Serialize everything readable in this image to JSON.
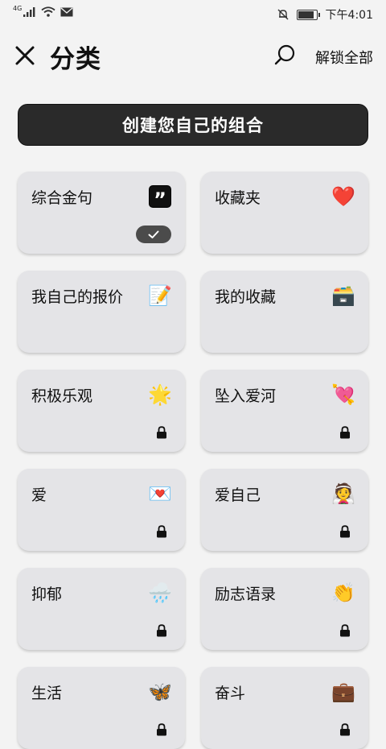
{
  "status_bar": {
    "signal_label": "4G",
    "time": "下午4:01"
  },
  "header": {
    "title": "分类",
    "unlock_all": "解锁全部",
    "close_icon": "close-icon",
    "search_icon": "search-icon"
  },
  "create_button": {
    "label": "创建您自己的组合"
  },
  "categories": [
    {
      "label": "综合金句",
      "icon": "quote-icon",
      "emoji": "”",
      "state": "selected"
    },
    {
      "label": "收藏夹",
      "icon": "heart-icon",
      "emoji": "❤️",
      "state": "unlocked"
    },
    {
      "label": "我自己的报价",
      "icon": "memo-icon",
      "emoji": "📝",
      "state": "unlocked"
    },
    {
      "label": "我的收藏",
      "icon": "box-icon",
      "emoji": "🗃️",
      "state": "unlocked"
    },
    {
      "label": "积极乐观",
      "icon": "star-icon",
      "emoji": "🌟",
      "state": "locked"
    },
    {
      "label": "坠入爱河",
      "icon": "heart-arrow-icon",
      "emoji": "💘",
      "state": "locked"
    },
    {
      "label": "爱",
      "icon": "love-letter-icon",
      "emoji": "💌",
      "state": "locked"
    },
    {
      "label": "爱自己",
      "icon": "bride-icon",
      "emoji": "👰",
      "state": "locked"
    },
    {
      "label": "抑郁",
      "icon": "rain-cloud-icon",
      "emoji": "🌧️",
      "state": "locked"
    },
    {
      "label": "励志语录",
      "icon": "clapping-hands-icon",
      "emoji": "👏",
      "state": "locked"
    },
    {
      "label": "生活",
      "icon": "butterfly-icon",
      "emoji": "🦋",
      "state": "locked"
    },
    {
      "label": "奋斗",
      "icon": "briefcase-icon",
      "emoji": "💼",
      "state": "locked"
    }
  ]
}
